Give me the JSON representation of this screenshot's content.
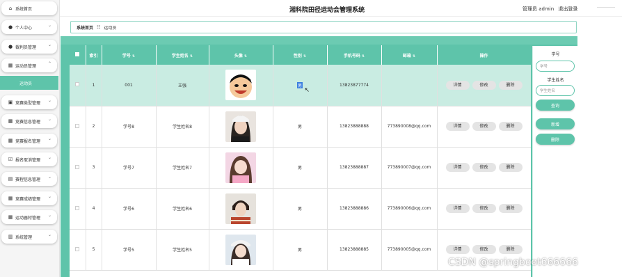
{
  "header": {
    "title": "湘科院田径运动会管理系统",
    "admin_label": "管理员 admin",
    "logout": "退出登录"
  },
  "sidebar": {
    "items": [
      {
        "label": "系统首页",
        "icon": "home-icon"
      },
      {
        "label": "个人中心",
        "icon": "user-icon"
      },
      {
        "label": "裁判员管理",
        "icon": "referee-icon"
      },
      {
        "label": "运动员管理",
        "icon": "grid-icon",
        "expanded": true
      },
      {
        "label": "竞赛类型管理",
        "icon": "briefcase-icon"
      },
      {
        "label": "竞赛信息管理",
        "icon": "grid-icon"
      },
      {
        "label": "竞赛报名管理",
        "icon": "grid-icon"
      },
      {
        "label": "报名取消管理",
        "icon": "checkbox-icon"
      },
      {
        "label": "赛程信息管理",
        "icon": "clipboard-icon"
      },
      {
        "label": "竞赛成绩管理",
        "icon": "grid-icon"
      },
      {
        "label": "运动器材管理",
        "icon": "grid-icon"
      },
      {
        "label": "系统管理",
        "icon": "trash-icon"
      }
    ],
    "sub_item": "运动员"
  },
  "breadcrumb": {
    "home": "系统首页",
    "separator": "☷",
    "current": "运动员"
  },
  "table": {
    "columns": [
      "索引",
      "学号",
      "学生姓名",
      "头像",
      "性别",
      "手机号码",
      "邮箱",
      "操作"
    ],
    "rows": [
      {
        "index": "1",
        "student_no": "001",
        "name": "王强",
        "gender": "男",
        "phone": "13823877774",
        "email": ""
      },
      {
        "index": "2",
        "student_no": "学号8",
        "name": "学生姓名8",
        "gender": "男",
        "phone": "13823888888",
        "email": "773890008@qq.com"
      },
      {
        "index": "3",
        "student_no": "学号7",
        "name": "学生姓名7",
        "gender": "男",
        "phone": "13823888887",
        "email": "773890007@qq.com"
      },
      {
        "index": "4",
        "student_no": "学号6",
        "name": "学生姓名6",
        "gender": "男",
        "phone": "13823888886",
        "email": "773890006@qq.com"
      },
      {
        "index": "5",
        "student_no": "学号5",
        "name": "学生姓名5",
        "gender": "男",
        "phone": "13823888885",
        "email": "773890005@qq.com"
      }
    ],
    "actions": {
      "detail": "详情",
      "edit": "修改",
      "delete": "删除"
    }
  },
  "search": {
    "student_no_label": "学号",
    "student_no_placeholder": "学号",
    "name_label": "学生姓名",
    "name_placeholder": "学生姓名",
    "query_button": "查询",
    "add_button": "新增",
    "delete_button": "删除"
  },
  "watermark": "CSDN @springboot666666",
  "colors": {
    "accent": "#5ec4aa",
    "selected_row": "#c9ece2",
    "button_gray": "#e4e4e4"
  }
}
